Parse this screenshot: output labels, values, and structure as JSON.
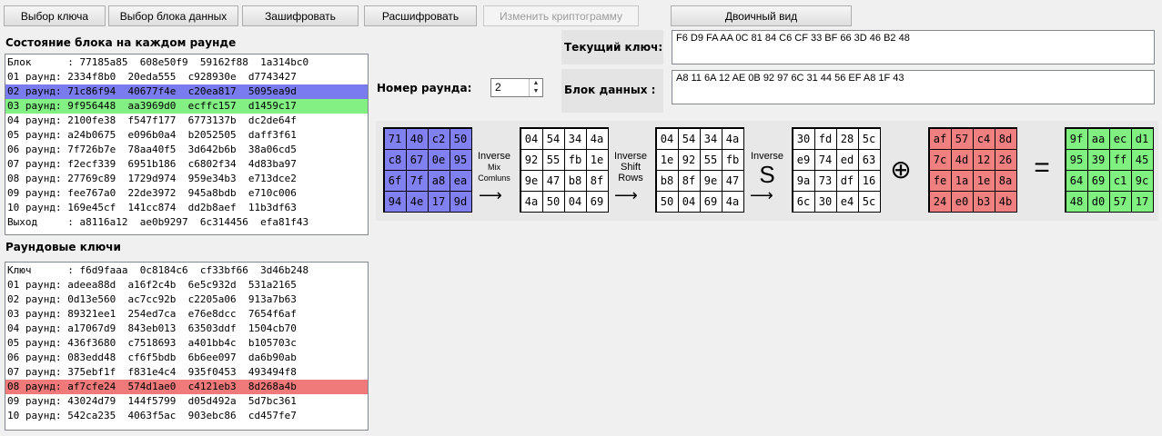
{
  "toolbar": {
    "select_key": "Выбор ключа",
    "select_block": "Выбор блока данных",
    "encrypt": "Зашифровать",
    "decrypt": "Расшифровать",
    "modify_ciphertext": "Изменить криптограмму",
    "binary_view": "Двоичный вид"
  },
  "state_section": {
    "title": "Состояние блока на каждом раунде",
    "rows": [
      "Блок      : 77185a85  608e50f9  59162f88  1a314bc0",
      "01 раунд: 2334f8b0  20eda555  c928930e  d7743427",
      "02 раунд: 71c86f94  40677f4e  c20ea817  5095ea9d",
      "03 раунд: 9f956448  aa3969d0  ecffc157  d1459c17",
      "04 раунд: 2100fe38  f547f177  6773137b  dc2de64f",
      "05 раунд: a24b0675  e096b0a4  b2052505  daff3f61",
      "06 раунд: 7f726b7e  78aa40f5  3d642b6b  38a06cd5",
      "07 раунд: f2ecf339  6951b186  c6802f34  4d83ba97",
      "08 раунд: 27769c89  1729d974  959e34b3  e713dce2",
      "09 раунд: fee767a0  22de3972  945a8bdb  e710c006",
      "10 раунд: 169e45cf  141cc874  dd2b8aef  11b3df63",
      "Выход     : a8116a12  ae0b9297  6c314456  efa81f43"
    ]
  },
  "keys_section": {
    "title": "Раундовые ключи",
    "rows": [
      "Ключ      : f6d9faaa  0c8184c6  cf33bf66  3d46b248",
      "01 раунд: adeea88d  a16f2c4b  6e5c932d  531a2165",
      "02 раунд: 0d13e560  ac7cc92b  c2205a06  913a7b63",
      "03 раунд: 89321ee1  254ed7ca  e76e8dcc  7654f6af",
      "04 раунд: a17067d9  843eb013  63503ddf  1504cb70",
      "05 раунд: 436f3680  c7518693  a401bb4c  b105703c",
      "06 раунд: 083edd48  cf6f5bdb  6b6ee097  da6b90ab",
      "07 раунд: 375ebf1f  f831e4c4  935f0453  493494f8",
      "08 раунд: af7cfe24  574d1ae0  c4121eb3  8d268a4b",
      "09 раунд: 43024d79  144f5799  d05d492a  5d7bc361",
      "10 раунд: 542ca235  4063f5ac  903ebc86  cd457fe7"
    ]
  },
  "current_key": {
    "label": "Текущий ключ:",
    "value": "F6 D9 FA AA 0C 81 84 C6 CF 33 BF 66 3D 46 B2 48"
  },
  "data_block": {
    "label": "Блок данных :",
    "value": "A8 11 6A 12 AE 0B 92 97 6C 31 44 56 EF A8 1F 43"
  },
  "round_number": {
    "label": "Номер раунда:",
    "value": "2"
  },
  "colors": {
    "blue": "#8080f0",
    "green": "#80f080",
    "red": "#f08080"
  },
  "operations": {
    "inv_mix": [
      "Inverse",
      "Mix",
      "Comluns"
    ],
    "inv_shift": [
      "Inverse",
      "Shift",
      "Rows"
    ],
    "inv_sub_label": "Inverse",
    "inv_sub_symbol": "S",
    "xor_symbol": "⊕",
    "equals_symbol": "="
  },
  "matrices": {
    "input": [
      [
        "71",
        "40",
        "c2",
        "50"
      ],
      [
        "c8",
        "67",
        "0e",
        "95"
      ],
      [
        "6f",
        "7f",
        "a8",
        "ea"
      ],
      [
        "94",
        "4e",
        "17",
        "9d"
      ]
    ],
    "after_mix": [
      [
        "04",
        "54",
        "34",
        "4a"
      ],
      [
        "92",
        "55",
        "fb",
        "1e"
      ],
      [
        "9e",
        "47",
        "b8",
        "8f"
      ],
      [
        "4a",
        "50",
        "04",
        "69"
      ]
    ],
    "after_shift": [
      [
        "04",
        "54",
        "34",
        "4a"
      ],
      [
        "1e",
        "92",
        "55",
        "fb"
      ],
      [
        "b8",
        "8f",
        "9e",
        "47"
      ],
      [
        "50",
        "04",
        "69",
        "4a"
      ]
    ],
    "after_sub": [
      [
        "30",
        "fd",
        "28",
        "5c"
      ],
      [
        "e9",
        "74",
        "ed",
        "63"
      ],
      [
        "9a",
        "73",
        "df",
        "16"
      ],
      [
        "6c",
        "30",
        "e4",
        "5c"
      ]
    ],
    "round_key": [
      [
        "af",
        "57",
        "c4",
        "8d"
      ],
      [
        "7c",
        "4d",
        "12",
        "26"
      ],
      [
        "fe",
        "1a",
        "1e",
        "8a"
      ],
      [
        "24",
        "e0",
        "b3",
        "4b"
      ]
    ],
    "result": [
      [
        "9f",
        "aa",
        "ec",
        "d1"
      ],
      [
        "95",
        "39",
        "ff",
        "45"
      ],
      [
        "64",
        "69",
        "c1",
        "9c"
      ],
      [
        "48",
        "d0",
        "57",
        "17"
      ]
    ]
  }
}
